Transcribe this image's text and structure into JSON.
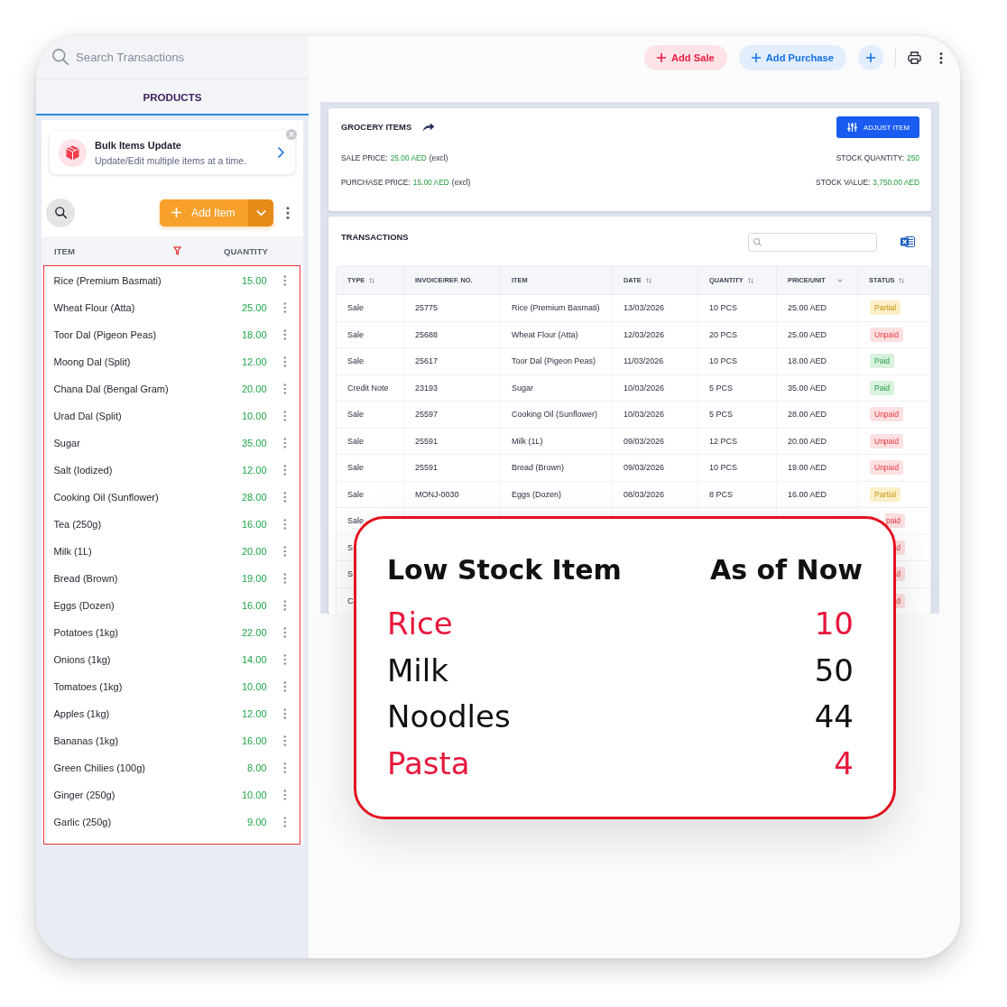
{
  "top_bar": {
    "search": {
      "placeholder": "Search Transactions"
    },
    "buttons": [
      {
        "label": "Add Sale",
        "kind": "sale"
      },
      {
        "label": "Add Purchase",
        "kind": "purchase"
      }
    ]
  },
  "products_panel": {
    "tab": {
      "label": "PRODUCTS",
      "selected": true
    },
    "promo": {
      "title": "Bulk Items Update",
      "subtitle": "Update/Edit multiple items at a time."
    },
    "add_button": "Add Item",
    "columns": [
      "ITEM",
      "QUANTITY"
    ],
    "items": [
      {
        "name": "Rice (Premium Basmati)",
        "quantity": "15.00"
      },
      {
        "name": "Wheat Flour (Atta)",
        "quantity": "25.00"
      },
      {
        "name": "Toor Dal (Pigeon Peas)",
        "quantity": "18.00"
      },
      {
        "name": "Moong Dal (Split)",
        "quantity": "12.00"
      },
      {
        "name": "Chana Dal (Bengal Gram)",
        "quantity": "20.00"
      },
      {
        "name": "Urad Dal (Split)",
        "quantity": "10.00"
      },
      {
        "name": "Sugar",
        "quantity": "35.00"
      },
      {
        "name": "Salt (Iodized)",
        "quantity": "12.00"
      },
      {
        "name": "Cooking Oil (Sunflower)",
        "quantity": "28.00"
      },
      {
        "name": "Tea (250g)",
        "quantity": "16.00"
      },
      {
        "name": "Milk (1L)",
        "quantity": "20.00"
      },
      {
        "name": "Bread (Brown)",
        "quantity": "19.00"
      },
      {
        "name": "Eggs (Dozen)",
        "quantity": "16.00"
      },
      {
        "name": "Potatoes (1kg)",
        "quantity": "22.00"
      },
      {
        "name": "Onions (1kg)",
        "quantity": "14.00"
      },
      {
        "name": "Tomatoes (1kg)",
        "quantity": "10.00"
      },
      {
        "name": "Apples (1kg)",
        "quantity": "12.00"
      },
      {
        "name": "Bananas (1kg)",
        "quantity": "16.00"
      },
      {
        "name": "Green Chilies (100g)",
        "quantity": "8.00"
      },
      {
        "name": "Ginger (250g)",
        "quantity": "10.00"
      },
      {
        "name": "Garlic (250g)",
        "quantity": "9.00"
      }
    ]
  },
  "item_details": {
    "title": "GROCERY ITEMS",
    "button": "ADJUST ITEM",
    "stats": [
      {
        "label": "SALE PRICE:",
        "value": "25.00 AED",
        "note": "(excl)"
      },
      {
        "label": "STOCK QUANTITY:",
        "value": "250"
      },
      {
        "label": "PURCHASE PRICE:",
        "value": "15.00 AED",
        "note": "(excl)"
      },
      {
        "label": "STOCK VALUE:",
        "value": "3,750.00 AED"
      }
    ]
  },
  "transactions": {
    "title": "TRANSACTIONS",
    "columns": [
      {
        "label": "TYPE",
        "kind": "sort"
      },
      {
        "label": "INVOICE/REF. NO.",
        "kind": "plain"
      },
      {
        "label": "ITEM",
        "kind": "plain"
      },
      {
        "label": "DATE",
        "kind": "sort"
      },
      {
        "label": "QUANTITY",
        "kind": "sort"
      },
      {
        "label": "PRICE/UNIT",
        "kind": "menu"
      },
      {
        "label": "STATUS",
        "kind": "sort"
      }
    ],
    "rows": [
      {
        "kind": "full",
        "type": "Sale",
        "invoice": "25775",
        "item": "Rice (Premium Basmati)",
        "date": "13/03/2026",
        "quantity": "10 PCS",
        "price": "25.00 AED",
        "status": {
          "text": "Partial",
          "kind": "partial"
        }
      },
      {
        "kind": "full",
        "type": "Sale",
        "invoice": "25688",
        "item": "Wheat Flour (Atta)",
        "date": "12/03/2026",
        "quantity": "20 PCS",
        "price": "25.00 AED",
        "status": {
          "text": "Unpaid",
          "kind": "unpaid"
        }
      },
      {
        "kind": "full",
        "type": "Sale",
        "invoice": "25617",
        "item": "Toor Dal (Pigeon Peas)",
        "date": "11/03/2026",
        "quantity": "10 PCS",
        "price": "18.00 AED",
        "status": {
          "text": "Paid",
          "kind": "paid"
        }
      },
      {
        "kind": "full",
        "type": "Credit Note",
        "invoice": "23193",
        "item": "Sugar",
        "date": "10/03/2026",
        "quantity": "5 PCS",
        "price": "35.00 AED",
        "status": {
          "text": "Paid",
          "kind": "paid"
        }
      },
      {
        "kind": "full",
        "type": "Sale",
        "invoice": "25597",
        "item": "Cooking Oil (Sunflower)",
        "date": "10/03/2026",
        "quantity": "5 PCS",
        "price": "28.00 AED",
        "status": {
          "text": "Unpaid",
          "kind": "unpaid"
        }
      },
      {
        "kind": "full",
        "type": "Sale",
        "invoice": "25591",
        "item": "Milk (1L)",
        "date": "09/03/2026",
        "quantity": "12 PCS",
        "price": "20.00 AED",
        "status": {
          "text": "Unpaid",
          "kind": "unpaid"
        }
      },
      {
        "kind": "full",
        "type": "Sale",
        "invoice": "25591",
        "item": "Bread (Brown)",
        "date": "09/03/2026",
        "quantity": "10 PCS",
        "price": "19.00 AED",
        "status": {
          "text": "Unpaid",
          "kind": "unpaid"
        }
      },
      {
        "kind": "full",
        "type": "Sale",
        "invoice": "MONJ-0030",
        "item": "Eggs (Dozen)",
        "date": "08/03/2026",
        "quantity": "8 PCS",
        "price": "16.00 AED",
        "status": {
          "text": "Partial",
          "kind": "partial"
        }
      },
      {
        "kind": "covered",
        "type": "Sale",
        "status": {
          "text": "paid",
          "kind": "unpaid"
        }
      },
      {
        "kind": "covered",
        "type": "S",
        "status": {
          "text": "d",
          "kind": "unpaid"
        }
      },
      {
        "kind": "covered",
        "type": "S",
        "status": {
          "text": "d",
          "kind": "unpaid"
        }
      },
      {
        "kind": "covered",
        "type": "C",
        "status": {
          "text": "d",
          "kind": "unpaid"
        }
      }
    ]
  },
  "low_stock": {
    "title": "Low Stock Item",
    "subtitle": "As of Now",
    "items": [
      {
        "name": "Rice",
        "count": "10",
        "color": "#e8173c"
      },
      {
        "name": "Milk",
        "count": "50",
        "color": "#111111"
      },
      {
        "name": "Noodles",
        "count": "44",
        "color": "#111111"
      },
      {
        "name": "Pasta",
        "count": "4",
        "color": "#e8173c"
      }
    ]
  }
}
